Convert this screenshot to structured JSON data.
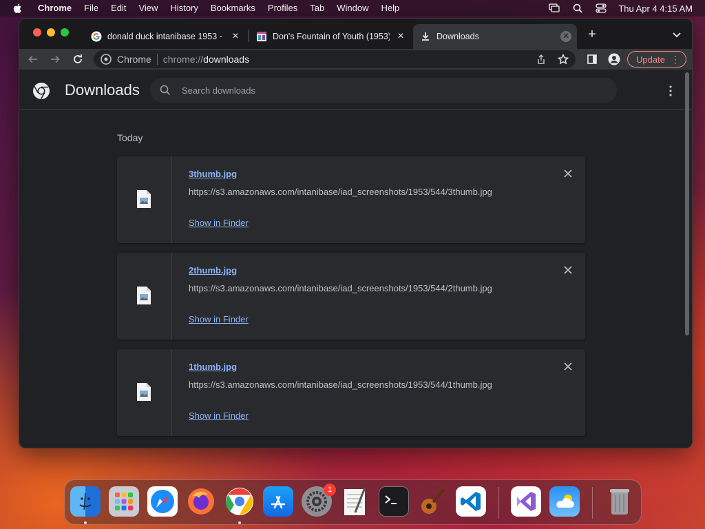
{
  "menubar": {
    "app_name": "Chrome",
    "items": [
      "File",
      "Edit",
      "View",
      "History",
      "Bookmarks",
      "Profiles",
      "Tab",
      "Window",
      "Help"
    ],
    "clock": "Thu Apr 4  4:15 AM"
  },
  "tabs": [
    {
      "title": "donald duck intanibase 1953 -",
      "favicon": "google-icon",
      "active": false
    },
    {
      "title": "Don's Fountain of Youth (1953)",
      "favicon": "image-icon",
      "active": false
    },
    {
      "title": "Downloads",
      "favicon": "download-icon",
      "active": true
    }
  ],
  "omnibox": {
    "chip": "Chrome",
    "scheme": "chrome://",
    "host": "downloads"
  },
  "update_label": "Update",
  "downloads_page": {
    "title": "Downloads",
    "search_placeholder": "Search downloads",
    "day_label": "Today",
    "items": [
      {
        "filename": "3thumb.jpg",
        "url": "https://s3.amazonaws.com/intanibase/iad_screenshots/1953/544/3thumb.jpg",
        "action": "Show in Finder"
      },
      {
        "filename": "2thumb.jpg",
        "url": "https://s3.amazonaws.com/intanibase/iad_screenshots/1953/544/2thumb.jpg",
        "action": "Show in Finder"
      },
      {
        "filename": "1thumb.jpg",
        "url": "https://s3.amazonaws.com/intanibase/iad_screenshots/1953/544/1thumb.jpg",
        "action": "Show in Finder"
      }
    ]
  },
  "dock": {
    "apps": [
      "finder-icon",
      "launchpad-icon",
      "safari-icon",
      "firefox-icon",
      "chrome-icon",
      "app-store-icon",
      "system-settings-icon",
      "textedit-icon",
      "terminal-icon",
      "garageband-icon",
      "vscode-icon",
      "visual-studio-icon",
      "weather-icon",
      "trash-icon"
    ],
    "settings_badge": "1"
  },
  "colors": {
    "accent_link": "#8ab4f8",
    "update_accent": "#f28b82",
    "page_bg": "#202124"
  }
}
